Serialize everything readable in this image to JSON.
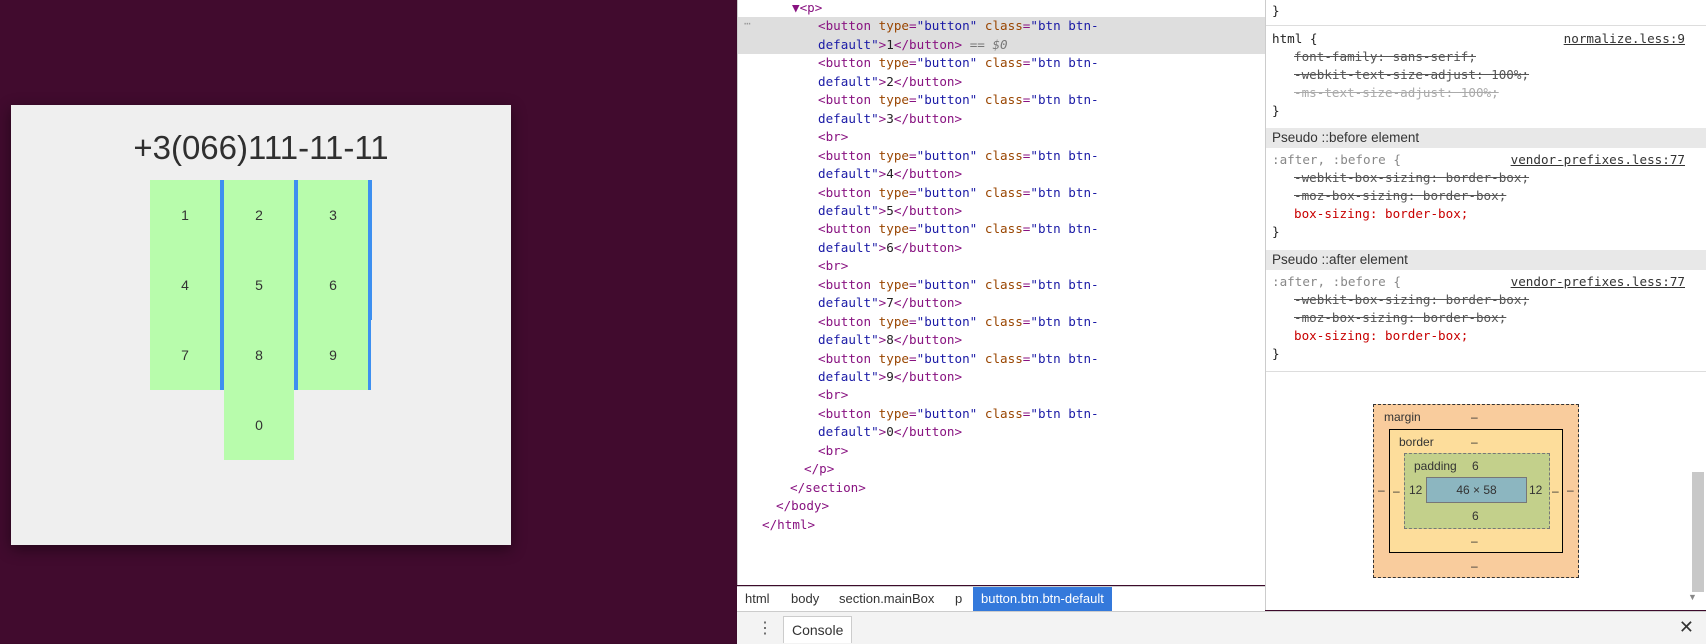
{
  "page": {
    "phone_display": "+3(066)111-11-11",
    "keys": [
      "1",
      "2",
      "3",
      "4",
      "5",
      "6",
      "7",
      "8",
      "9",
      "0"
    ]
  },
  "dom": {
    "lines": [
      {
        "text": "▼<p>",
        "kind": "open"
      },
      {
        "text": "<button type=\"button\" class=\"btn btn-",
        "kind": "button"
      },
      {
        "text": "default\">1</button> == $0",
        "kind": "btncont"
      },
      {
        "text": "<button type=\"button\" class=\"btn btn-",
        "kind": "button"
      },
      {
        "text": "default\">2</button>",
        "kind": "btncont"
      },
      {
        "text": "<button type=\"button\" class=\"btn btn-",
        "kind": "button"
      },
      {
        "text": "default\">3</button>",
        "kind": "btncont"
      },
      {
        "text": "<br>",
        "kind": "br"
      },
      {
        "text": "<button type=\"button\" class=\"btn btn-",
        "kind": "button"
      },
      {
        "text": "default\">4</button>",
        "kind": "btncont"
      },
      {
        "text": "<button type=\"button\" class=\"btn btn-",
        "kind": "button"
      },
      {
        "text": "default\">5</button>",
        "kind": "btncont"
      },
      {
        "text": "<button type=\"button\" class=\"btn btn-",
        "kind": "button"
      },
      {
        "text": "default\">6</button>",
        "kind": "btncont"
      },
      {
        "text": "<br>",
        "kind": "br"
      },
      {
        "text": "<button type=\"button\" class=\"btn btn-",
        "kind": "button"
      },
      {
        "text": "default\">7</button>",
        "kind": "btncont"
      },
      {
        "text": "<button type=\"button\" class=\"btn btn-",
        "kind": "button"
      },
      {
        "text": "default\">8</button>",
        "kind": "btncont"
      },
      {
        "text": "<button type=\"button\" class=\"btn btn-",
        "kind": "button"
      },
      {
        "text": "default\">9</button>",
        "kind": "btncont"
      },
      {
        "text": "<br>",
        "kind": "br"
      },
      {
        "text": "<button type=\"button\" class=\"btn btn-",
        "kind": "button"
      },
      {
        "text": "default\">0</button>",
        "kind": "btncont"
      },
      {
        "text": "<br>",
        "kind": "br"
      },
      {
        "text": "</p>",
        "kind": "close"
      },
      {
        "text": "</section>",
        "kind": "close"
      },
      {
        "text": "</body>",
        "kind": "close"
      },
      {
        "text": "</html>",
        "kind": "close"
      }
    ],
    "selected_marker": "== $0",
    "gutter_icon": "⋯"
  },
  "breadcrumbs": [
    "html",
    "body",
    "section.mainBox",
    "p",
    "button.btn.btn-default"
  ],
  "styles": {
    "top_brace": "}",
    "html_rule": {
      "selector": "html {",
      "source": "normalize.less:9",
      "props": [
        "font-family: sans-serif;",
        "-webkit-text-size-adjust: 100%;",
        "-ms-text-size-adjust: 100%;"
      ]
    },
    "pseudo_before": {
      "header": "Pseudo ::before element",
      "selector": ":after, :before {",
      "source": "vendor-prefixes.less:77",
      "props": [
        "-webkit-box-sizing: border-box;",
        "-moz-box-sizing: border-box;",
        "box-sizing: border-box;"
      ]
    },
    "pseudo_after": {
      "header": "Pseudo ::after element",
      "selector": ":after, :before {",
      "source": "vendor-prefixes.less:77",
      "props": [
        "-webkit-box-sizing: border-box;",
        "-moz-box-sizing: border-box;",
        "box-sizing: border-box;"
      ]
    },
    "close_brace": "}"
  },
  "box_model": {
    "margin_label": "margin",
    "margin_value": "–",
    "border_label": "border",
    "border_value": "–",
    "padding_label": "padding",
    "padding_top": "6",
    "padding_bottom": "6",
    "padding_left": "12",
    "padding_right": "12",
    "content": "46 × 58",
    "dash": "–"
  },
  "console": {
    "tab_label": "Console",
    "menu_icon": "vertical-dots-icon",
    "close_icon": "close-icon"
  },
  "colors": {
    "page_bg": "#410b2e",
    "key_bg": "#b8fcac",
    "accent": "#3479db"
  }
}
